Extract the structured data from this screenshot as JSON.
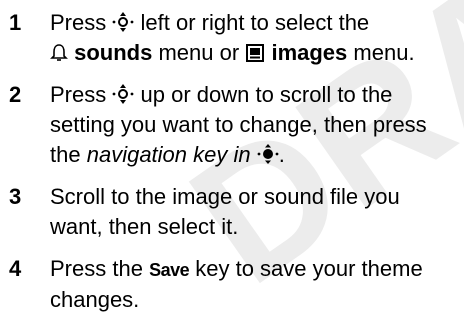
{
  "watermark": {
    "text": "DRAFT",
    "color": "#e8e8e8"
  },
  "steps": [
    {
      "number": "1",
      "pre": "Press",
      "icon1": "nav-key-icon",
      "mid": "left or right to select the",
      "icon2": "bell-icon",
      "menu1": "sounds",
      "between": "menu or",
      "icon3": "picture-icon",
      "menu2": "images",
      "post": "menu."
    },
    {
      "number": "2",
      "pre": "Press",
      "icon1": "nav-key-icon",
      "mid": "up or down to scroll to the setting you want to change, then press the",
      "key": "navigation key in",
      "icon2": "nav-key-center-icon",
      "post": "."
    },
    {
      "number": "3",
      "text": "Scroll to the image or sound file you want, then select it."
    },
    {
      "number": "4",
      "pre": "Press the",
      "key": "Save",
      "post": "key to save your theme changes."
    }
  ]
}
